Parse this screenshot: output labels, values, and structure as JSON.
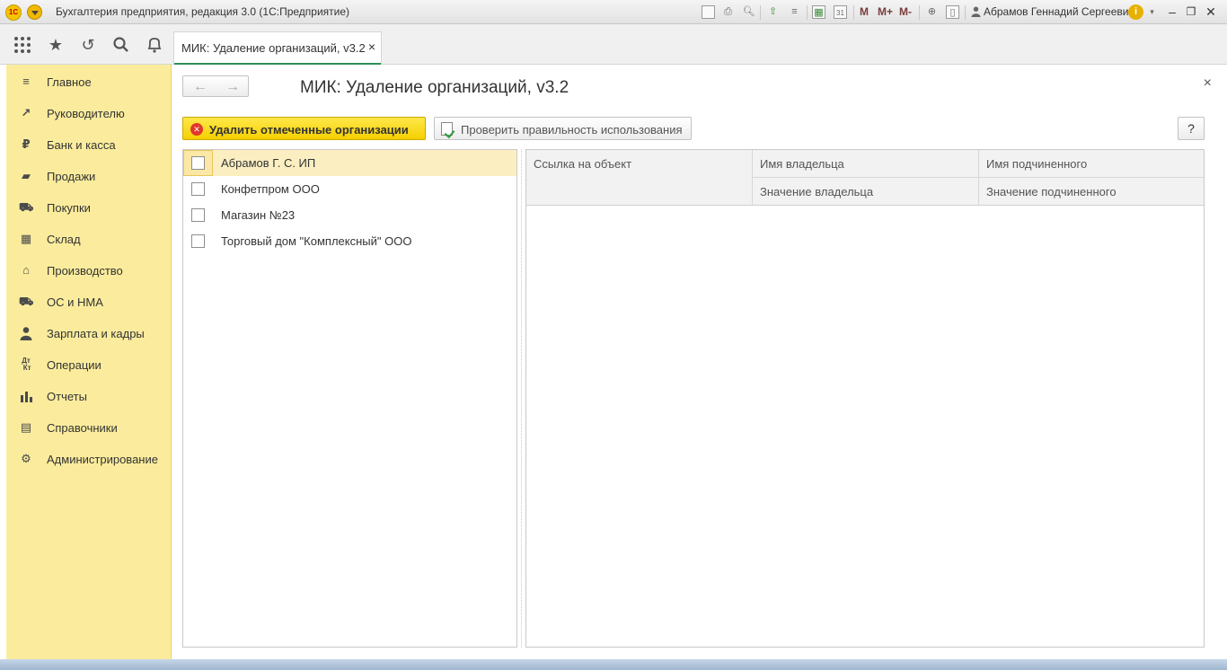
{
  "window": {
    "app_title": "Бухгалтерия предприятия, редакция 3.0  (1С:Предприятие)",
    "logo_text": "1С",
    "user_name": "Абрамов Геннадий Сергеевич",
    "toolbar_m_labels": [
      "M",
      "M+",
      "M-"
    ]
  },
  "tabs": [
    {
      "label": "МИК: Удаление организаций, v3.2",
      "close": "×"
    }
  ],
  "sidebar": {
    "items": [
      {
        "label": "Главное",
        "icon": "menu-lines-icon"
      },
      {
        "label": "Руководителю",
        "icon": "trend-up-icon"
      },
      {
        "label": "Банк и касса",
        "icon": "ruble-coin-icon"
      },
      {
        "label": "Продажи",
        "icon": "shopping-bag-icon"
      },
      {
        "label": "Покупки",
        "icon": "cart-icon"
      },
      {
        "label": "Склад",
        "icon": "warehouse-icon"
      },
      {
        "label": "Производство",
        "icon": "factory-icon"
      },
      {
        "label": "ОС и НМА",
        "icon": "truck-icon"
      },
      {
        "label": "Зарплата и кадры",
        "icon": "person-icon"
      },
      {
        "label": "Операции",
        "icon": "dt-kt-icon"
      },
      {
        "label": "Отчеты",
        "icon": "bar-chart-icon"
      },
      {
        "label": "Справочники",
        "icon": "books-icon"
      },
      {
        "label": "Администрирование",
        "icon": "gear-icon"
      }
    ]
  },
  "form": {
    "title": "МИК: Удаление организаций, v3.2",
    "close": "×",
    "delete_button": "Удалить отмеченные организации",
    "check_button": "Проверить правильность использования",
    "help_button": "?"
  },
  "organizations": [
    {
      "name": "Абрамов Г. С. ИП",
      "checked": false,
      "selected": true
    },
    {
      "name": "Конфетпром ООО",
      "checked": false,
      "selected": false
    },
    {
      "name": "Магазин №23",
      "checked": false,
      "selected": false
    },
    {
      "name": "Торговый дом \"Комплексный\" ООО",
      "checked": false,
      "selected": false
    }
  ],
  "references_table": {
    "columns": {
      "object_ref": "Ссылка на объект",
      "owner_name": "Имя владельца",
      "subordinate_name": "Имя подчиненного",
      "owner_value": "Значение владельца",
      "subordinate_value": "Значение подчиненного"
    },
    "rows": []
  }
}
